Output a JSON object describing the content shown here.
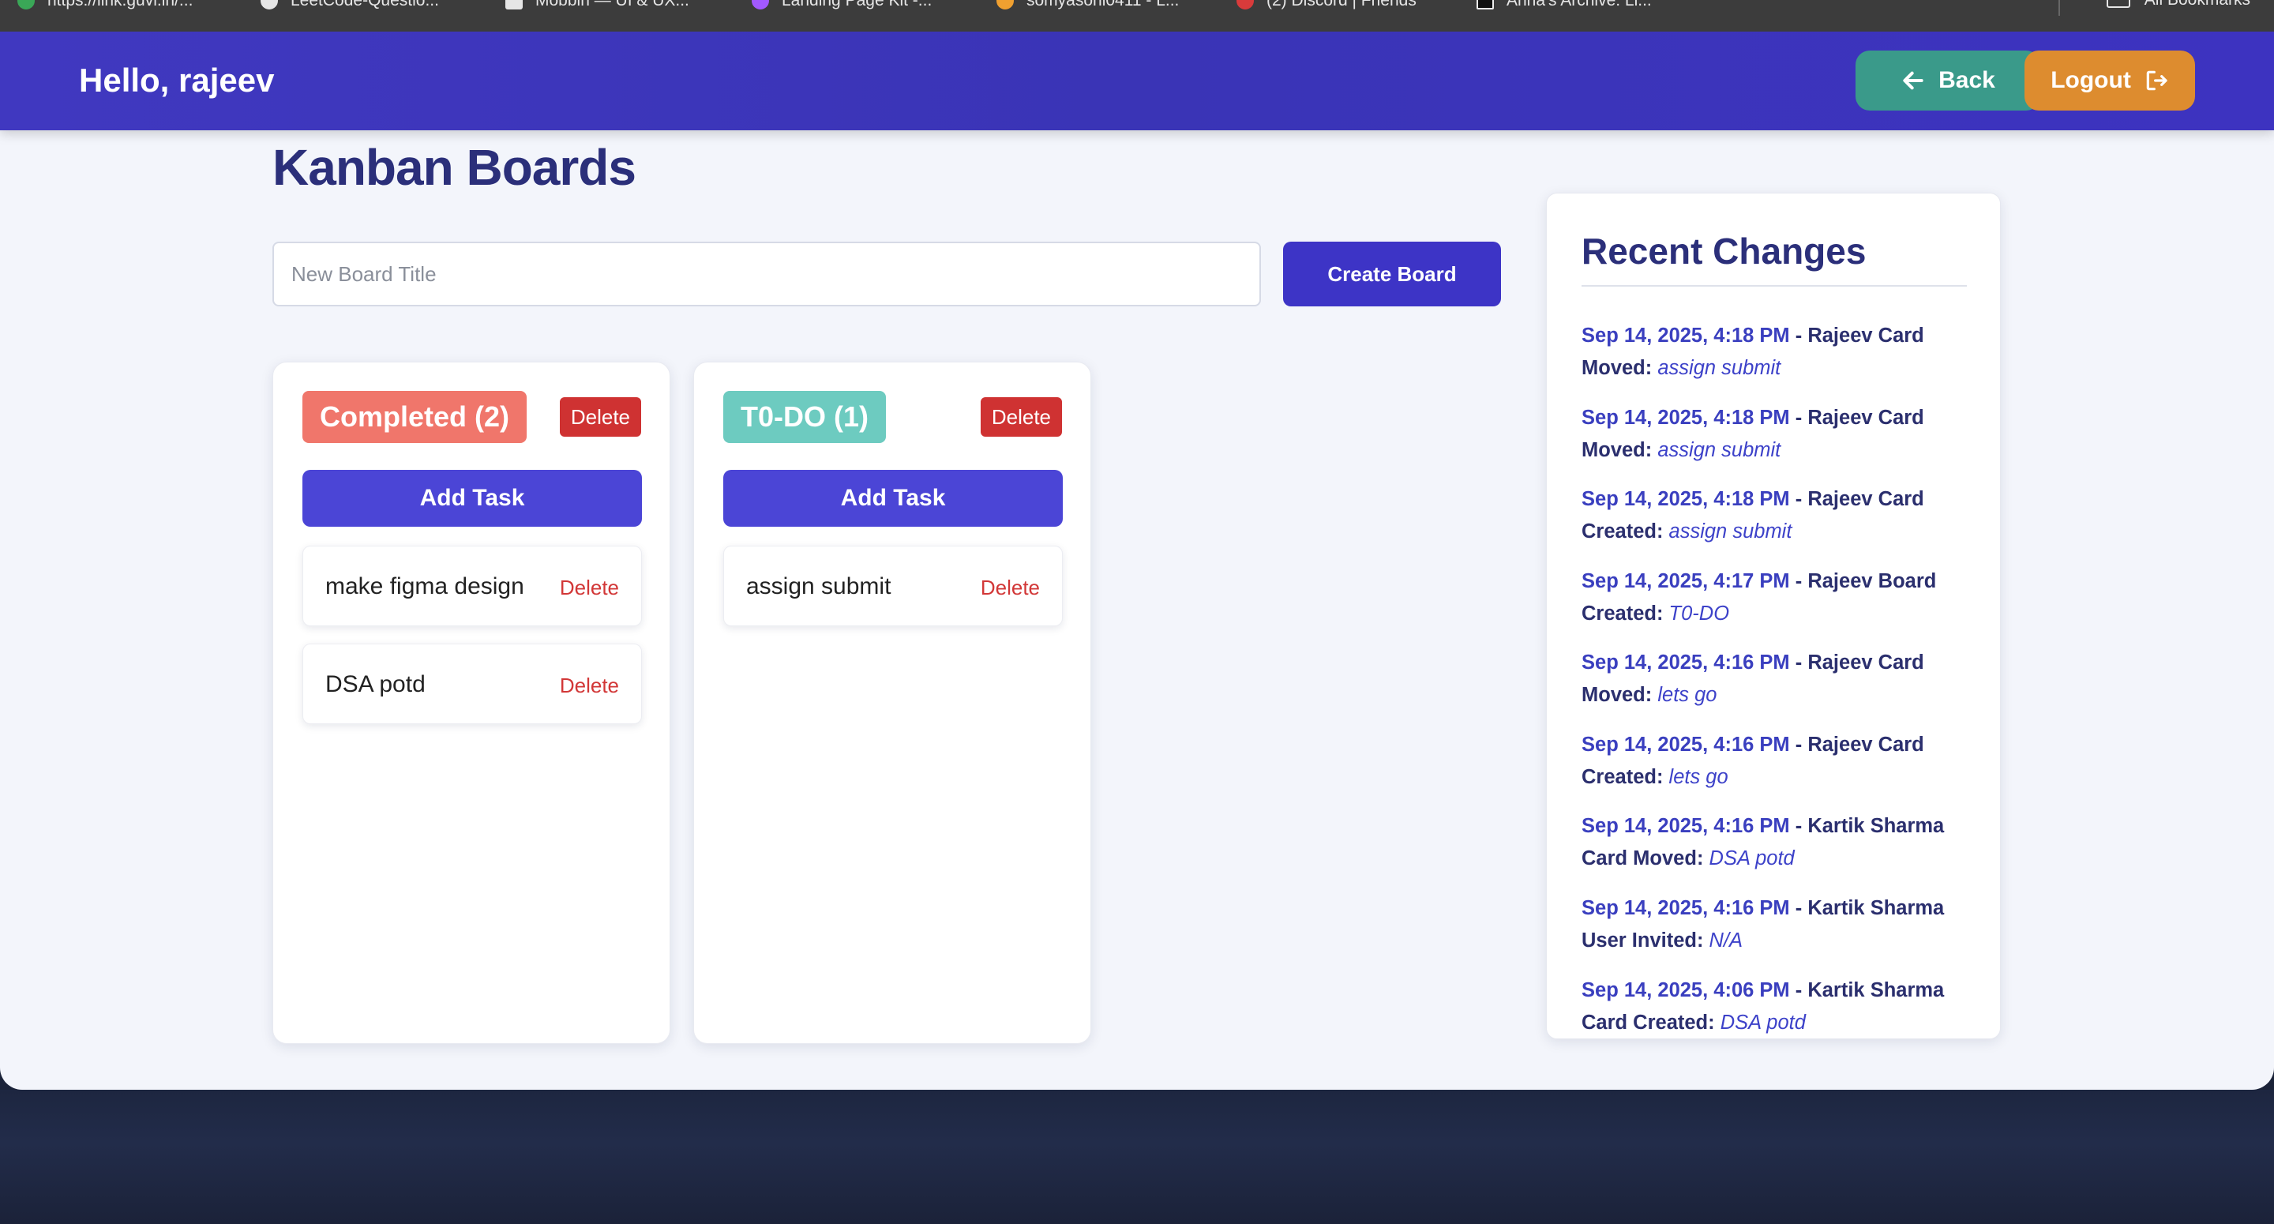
{
  "bookmarks": [
    {
      "label": "https://link.guvi.in/...",
      "color": "#3aa757"
    },
    {
      "label": "LeetCode-Questio...",
      "color": "#e6e6e6"
    },
    {
      "label": "Mobbin — UI & UX...",
      "color": "#e6e6e6"
    },
    {
      "label": "Landing Page Kit -...",
      "color": "#a259ff"
    },
    {
      "label": "somyasoni0411 - L...",
      "color": "#f0a030"
    },
    {
      "label": "(2) Discord | Friends",
      "color": "#d93b3b"
    },
    {
      "label": "Anna's Archive: Li...",
      "color": "#111111"
    }
  ],
  "all_bookmarks_label": "All Bookmarks",
  "header": {
    "greeting": "Hello, rajeev",
    "back_label": "Back",
    "logout_label": "Logout"
  },
  "page_title": "Kanban Boards",
  "new_board": {
    "placeholder": "New Board Title",
    "create_label": "Create Board"
  },
  "boards": [
    {
      "title": "Completed (2)",
      "color": "#f0766b",
      "delete_label": "Delete",
      "add_task_label": "Add Task",
      "tasks": [
        {
          "label": "make figma design",
          "delete_label": "Delete"
        },
        {
          "label": "DSA potd",
          "delete_label": "Delete"
        }
      ]
    },
    {
      "title": "T0-DO (1)",
      "color": "#6dcbc0",
      "delete_label": "Delete",
      "add_task_label": "Add Task",
      "tasks": [
        {
          "label": "assign submit",
          "delete_label": "Delete"
        }
      ]
    }
  ],
  "recent_changes": {
    "title": "Recent Changes",
    "items": [
      {
        "timestamp": "Sep 14, 2025, 4:18 PM",
        "actor": "Rajeev",
        "action": "Card Moved",
        "target": "assign submit"
      },
      {
        "timestamp": "Sep 14, 2025, 4:18 PM",
        "actor": "Rajeev",
        "action": "Card Moved",
        "target": "assign submit"
      },
      {
        "timestamp": "Sep 14, 2025, 4:18 PM",
        "actor": "Rajeev",
        "action": "Card Created",
        "target": "assign submit"
      },
      {
        "timestamp": "Sep 14, 2025, 4:17 PM",
        "actor": "Rajeev",
        "action": "Board Created",
        "target": "T0-DO"
      },
      {
        "timestamp": "Sep 14, 2025, 4:16 PM",
        "actor": "Rajeev",
        "action": "Card Moved",
        "target": "lets go"
      },
      {
        "timestamp": "Sep 14, 2025, 4:16 PM",
        "actor": "Rajeev",
        "action": "Card Created",
        "target": "lets go"
      },
      {
        "timestamp": "Sep 14, 2025, 4:16 PM",
        "actor": "Kartik Sharma",
        "action": "Card Moved",
        "target": "DSA potd"
      },
      {
        "timestamp": "Sep 14, 2025, 4:16 PM",
        "actor": "Kartik Sharma",
        "action": "User Invited",
        "target": "N/A"
      },
      {
        "timestamp": "Sep 14, 2025, 4:06 PM",
        "actor": "Kartik Sharma",
        "action": "Card Created",
        "target": "DSA potd"
      }
    ]
  }
}
